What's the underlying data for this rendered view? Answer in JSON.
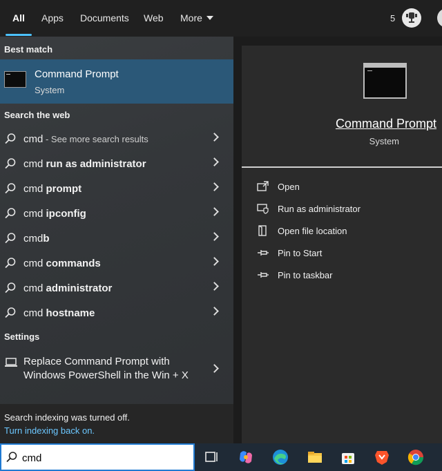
{
  "tabs": [
    {
      "label": "All",
      "active": true
    },
    {
      "label": "Apps"
    },
    {
      "label": "Documents"
    },
    {
      "label": "Web"
    },
    {
      "label": "More"
    }
  ],
  "header": {
    "points": "5",
    "reward_icon": "trophy-icon"
  },
  "left": {
    "best_match_title": "Best match",
    "best_match": {
      "title": "Command Prompt",
      "subtitle": "System",
      "icon": "terminal-icon"
    },
    "web_title": "Search the web",
    "web_results": [
      {
        "prefix": "cmd",
        "bold": "",
        "dim": " - See more search results"
      },
      {
        "prefix": "cmd ",
        "bold": "run as administrator",
        "dim": ""
      },
      {
        "prefix": "cmd ",
        "bold": "prompt",
        "dim": ""
      },
      {
        "prefix": "cmd ",
        "bold": "ipconfig",
        "dim": ""
      },
      {
        "prefix": "cmd",
        "bold": "b",
        "dim": ""
      },
      {
        "prefix": "cmd ",
        "bold": "commands",
        "dim": ""
      },
      {
        "prefix": "cmd ",
        "bold": "administrator",
        "dim": ""
      },
      {
        "prefix": "cmd ",
        "bold": "hostname",
        "dim": ""
      }
    ],
    "settings_title": "Settings",
    "settings_result": "Replace Command Prompt with Windows PowerShell in the Win + X",
    "notice_text": "Search indexing was turned off.",
    "notice_link": "Turn indexing back on."
  },
  "right": {
    "app_title": "Command Prompt",
    "app_subtitle": "System",
    "actions": [
      {
        "label": "Open",
        "icon": "open-icon"
      },
      {
        "label": "Run as administrator",
        "icon": "shield-icon"
      },
      {
        "label": "Open file location",
        "icon": "file-location-icon"
      },
      {
        "label": "Pin to Start",
        "icon": "pin-icon"
      },
      {
        "label": "Pin to taskbar",
        "icon": "pin-icon"
      }
    ]
  },
  "search": {
    "value": "cmd"
  },
  "taskbar": {
    "apps": [
      "task-view-icon",
      "copilot-icon",
      "edge-icon",
      "file-explorer-icon",
      "store-icon",
      "brave-icon",
      "chrome-icon"
    ]
  }
}
